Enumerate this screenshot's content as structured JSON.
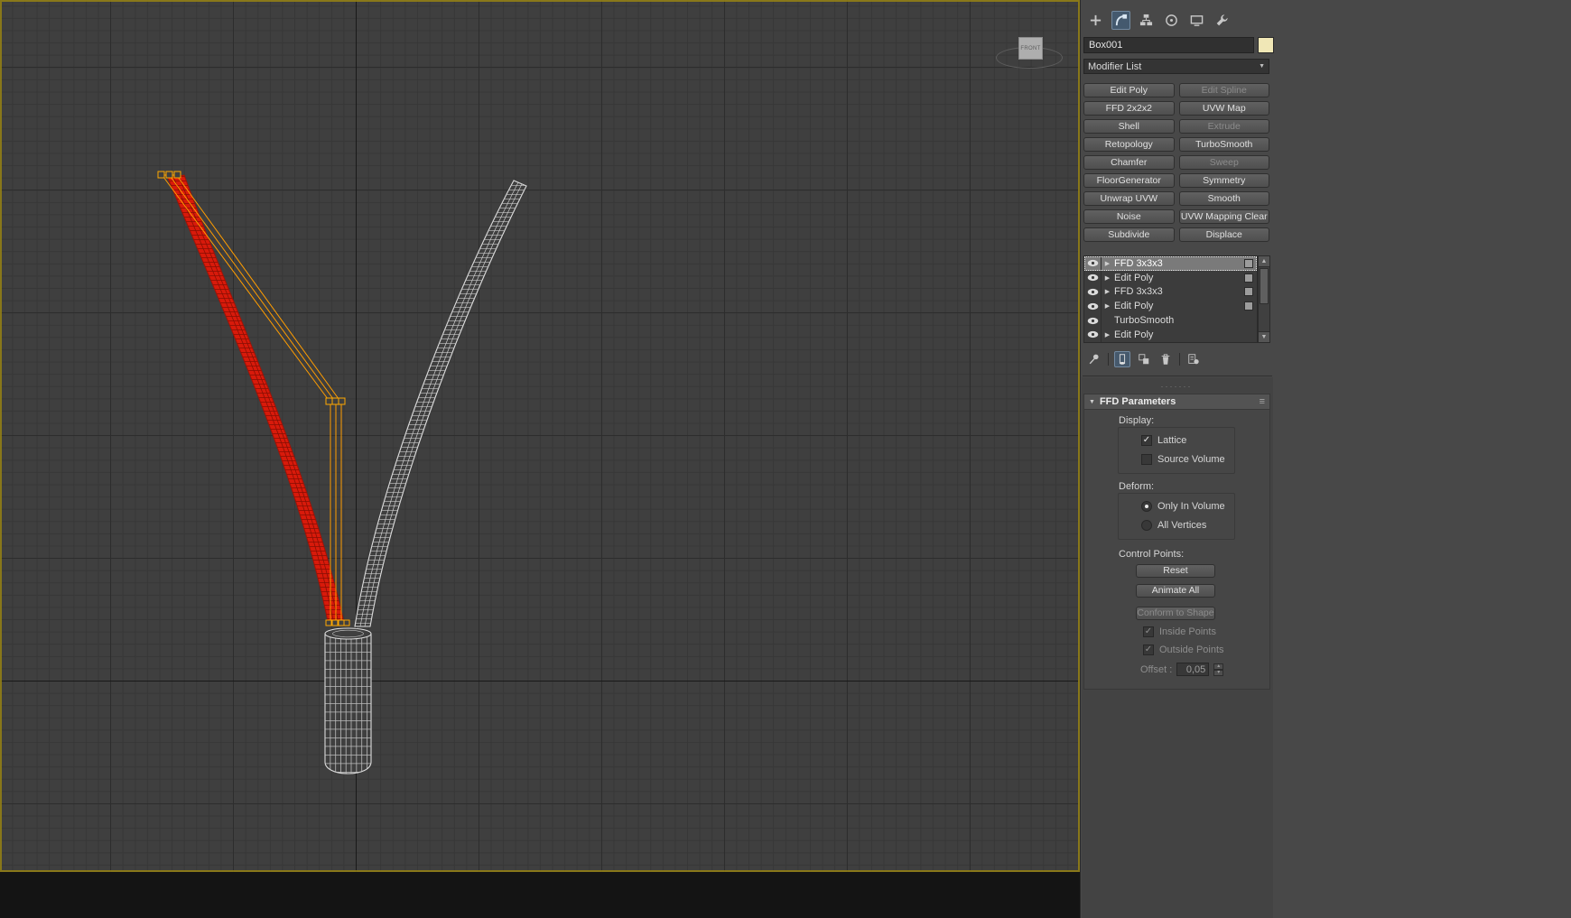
{
  "viewport": {
    "viewcube_front_label": "FRONT"
  },
  "icons": {
    "expand_arrow": "▶",
    "collapse_arrow": "▼",
    "dropdown_arrow": "▼",
    "menu": "≡",
    "scroll_up": "▲",
    "scroll_down": "▼",
    "spin_up": "▴",
    "spin_down": "▾",
    "checkmark": "✓",
    "grip_dots": "·······"
  },
  "colors": {
    "selection_red": "#d81a0b",
    "lattice_orange": "#ff9d00",
    "viewport_border_yellow": "#968214",
    "object_color_swatch": "#f0e7b6",
    "active_tab_blue": "#44596e"
  },
  "command_panel": {
    "object_name": "Box001",
    "modifier_list_label": "Modifier List",
    "modifier_buttons": [
      {
        "label": "Edit Poly",
        "enabled": true
      },
      {
        "label": "Edit Spline",
        "enabled": false
      },
      {
        "label": "FFD 2x2x2",
        "enabled": true
      },
      {
        "label": "UVW Map",
        "enabled": true
      },
      {
        "label": "Shell",
        "enabled": true
      },
      {
        "label": "Extrude",
        "enabled": false
      },
      {
        "label": "Retopology",
        "enabled": true
      },
      {
        "label": "TurboSmooth",
        "enabled": true
      },
      {
        "label": "Chamfer",
        "enabled": true
      },
      {
        "label": "Sweep",
        "enabled": false
      },
      {
        "label": "FloorGenerator",
        "enabled": true
      },
      {
        "label": "Symmetry",
        "enabled": true
      },
      {
        "label": "Unwrap UVW",
        "enabled": true
      },
      {
        "label": "Smooth",
        "enabled": true
      },
      {
        "label": "Noise",
        "enabled": true
      },
      {
        "label": "UVW Mapping Clear",
        "enabled": true
      },
      {
        "label": "Subdivide",
        "enabled": true
      },
      {
        "label": "Displace",
        "enabled": true
      }
    ],
    "modifier_stack": [
      {
        "label": "FFD 3x3x3",
        "selected": true
      },
      {
        "label": "Edit Poly",
        "selected": false
      },
      {
        "label": "FFD 3x3x3",
        "selected": false
      },
      {
        "label": "Edit Poly",
        "selected": false
      },
      {
        "label": "TurboSmooth",
        "selected": false
      },
      {
        "label": "Edit Poly",
        "selected": false
      }
    ],
    "ffd_parameters": {
      "title": "FFD Parameters",
      "display_label": "Display:",
      "lattice": "Lattice",
      "source_volume": "Source Volume",
      "deform_label": "Deform:",
      "only_in_volume": "Only In Volume",
      "all_vertices": "All Vertices",
      "control_points_label": "Control Points:",
      "reset": "Reset",
      "animate_all": "Animate All",
      "conform_to_shape": "Conform to Shape",
      "inside_points": "Inside Points",
      "outside_points": "Outside Points",
      "offset_label": "Offset :",
      "offset_value": "0,05"
    }
  }
}
